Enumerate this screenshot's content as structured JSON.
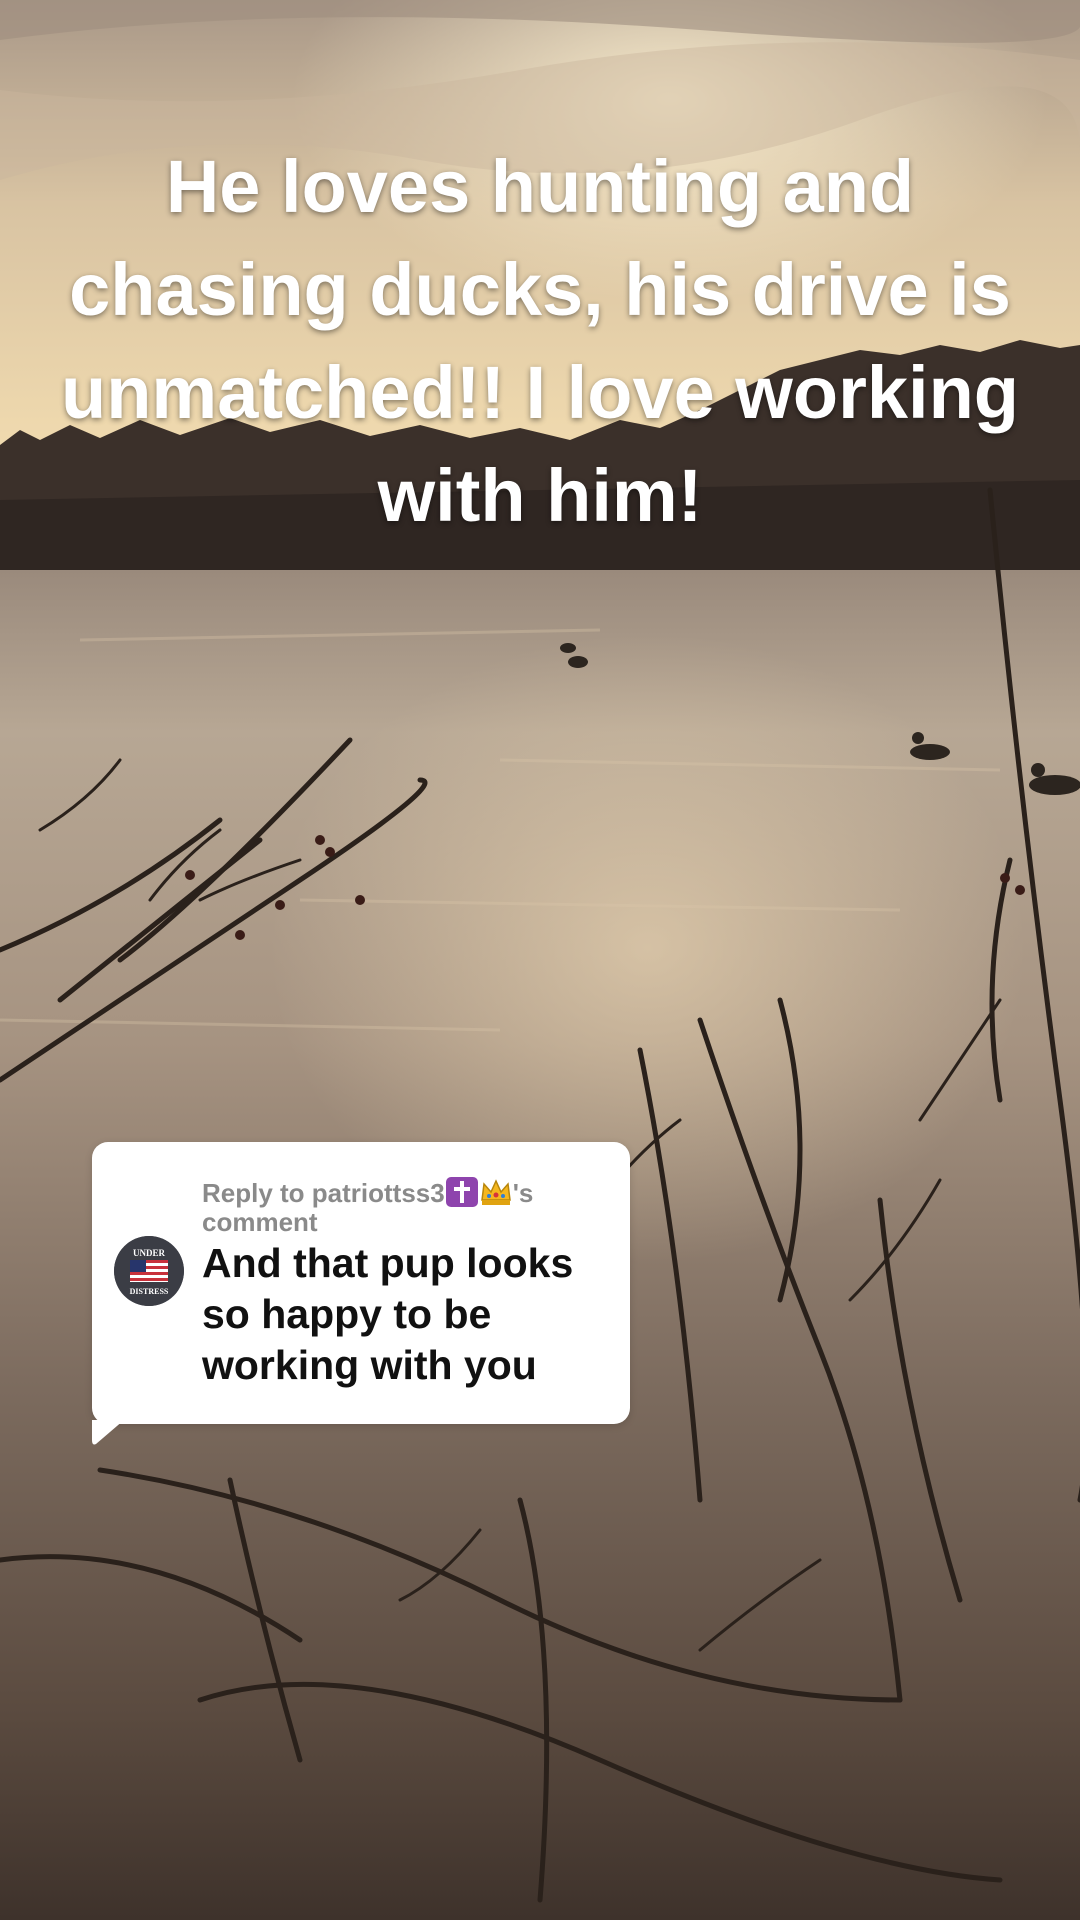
{
  "video": {
    "caption": "He loves hunting and chasing ducks, his drive is unmatched!! I love working with him!"
  },
  "reply_card": {
    "header_prefix": "Reply to patriottss3",
    "header_suffix": "'s comment",
    "header_emojis": [
      "cross-icon",
      "crown-icon"
    ],
    "avatar_text_top": "UNDER",
    "avatar_text_bottom": "DISTRESS",
    "comment": "And that pup looks so happy to be working with you"
  }
}
